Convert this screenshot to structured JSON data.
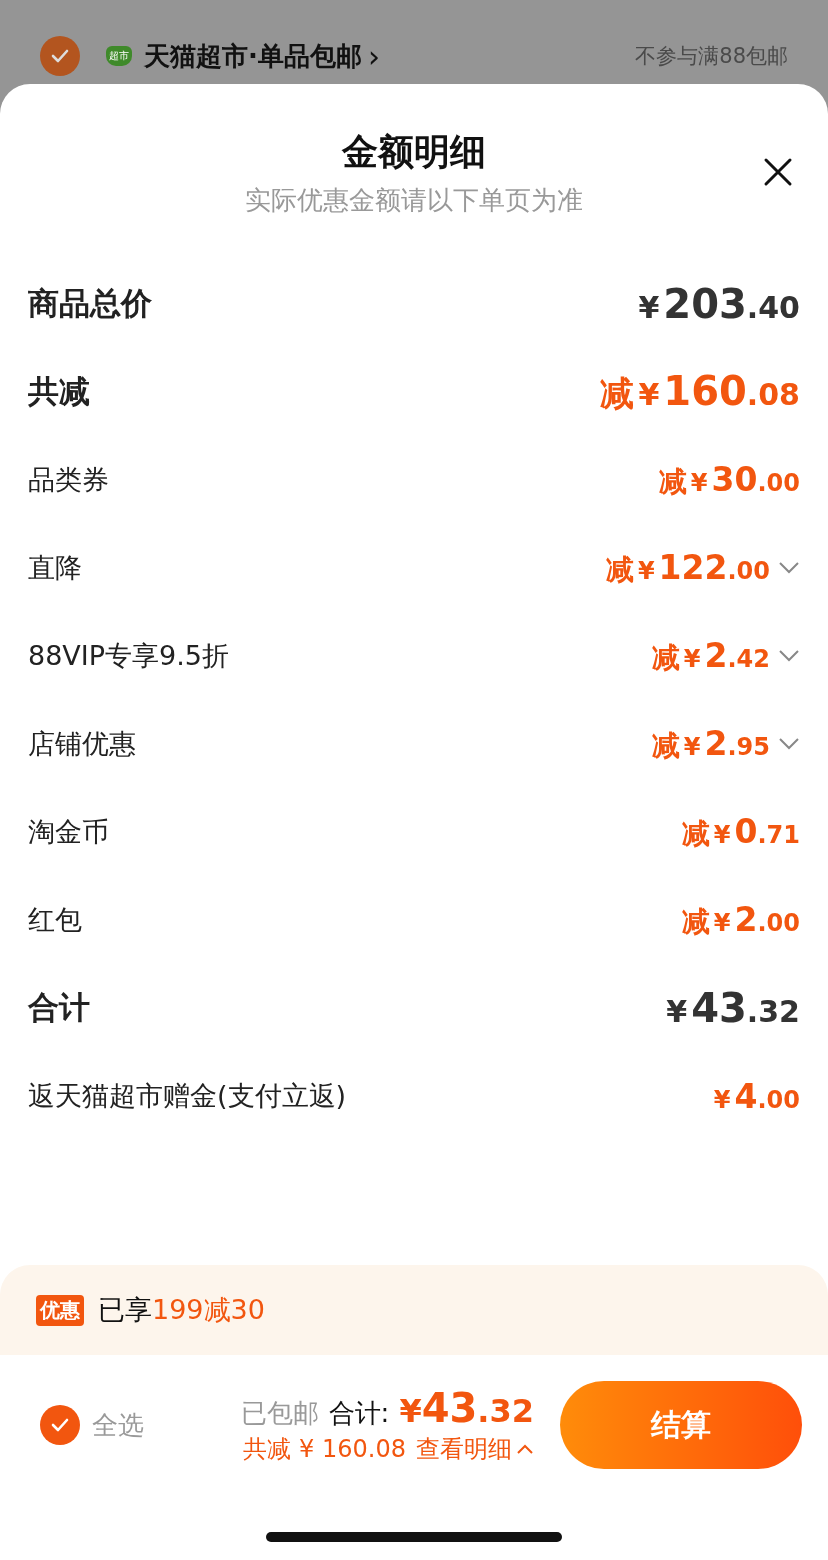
{
  "background_store": {
    "checked": true,
    "logo_text": "超市",
    "name": "天猫超市·单品包邮",
    "chevron": "›",
    "note": "不参与满88包邮"
  },
  "sheet": {
    "title": "金额明细",
    "subtitle": "实际优惠金额请以下单页为准",
    "rows": [
      {
        "kind": "major",
        "label": "商品总价",
        "discount": false,
        "prefix": "",
        "currency": "¥",
        "whole": "203",
        "cents": ".40",
        "expandable": false
      },
      {
        "kind": "major",
        "label": "共减",
        "discount": true,
        "prefix": "减",
        "currency": "¥",
        "whole": "160",
        "cents": ".08",
        "expandable": false
      },
      {
        "kind": "minor",
        "label": "品类券",
        "discount": true,
        "prefix": "减",
        "currency": "¥",
        "whole": "30",
        "cents": ".00",
        "expandable": false
      },
      {
        "kind": "minor",
        "label": "直降",
        "discount": true,
        "prefix": "减",
        "currency": "¥",
        "whole": "122",
        "cents": ".00",
        "expandable": true
      },
      {
        "kind": "minor",
        "label": "88VIP专享9.5折",
        "discount": true,
        "prefix": "减",
        "currency": "¥",
        "whole": "2",
        "cents": ".42",
        "expandable": true
      },
      {
        "kind": "minor",
        "label": "店铺优惠",
        "discount": true,
        "prefix": "减",
        "currency": "¥",
        "whole": "2",
        "cents": ".95",
        "expandable": true
      },
      {
        "kind": "minor",
        "label": "淘金币",
        "discount": true,
        "prefix": "减",
        "currency": "¥",
        "whole": "0",
        "cents": ".71",
        "expandable": false
      },
      {
        "kind": "minor",
        "label": "红包",
        "discount": true,
        "prefix": "减",
        "currency": "¥",
        "whole": "2",
        "cents": ".00",
        "expandable": false
      },
      {
        "kind": "major",
        "label": "合计",
        "discount": false,
        "prefix": "",
        "currency": "¥",
        "whole": "43",
        "cents": ".32",
        "expandable": false
      },
      {
        "kind": "minor",
        "label": "返天猫超市赠金(支付立返)",
        "discount": true,
        "prefix": "",
        "currency": "¥",
        "whole": "4",
        "cents": ".00",
        "expandable": false
      }
    ]
  },
  "promo": {
    "tag": "优惠",
    "text": "已享",
    "highlight": "199减30"
  },
  "footer": {
    "select_all": {
      "label": "全选",
      "checked": true
    },
    "shipping": "已包邮",
    "total_label": "合计:",
    "total_currency": "¥",
    "total_whole": "43",
    "total_cents": ".32",
    "saved": "共减 ¥ 160.08",
    "details_link": "查看明细",
    "checkout": "结算"
  }
}
